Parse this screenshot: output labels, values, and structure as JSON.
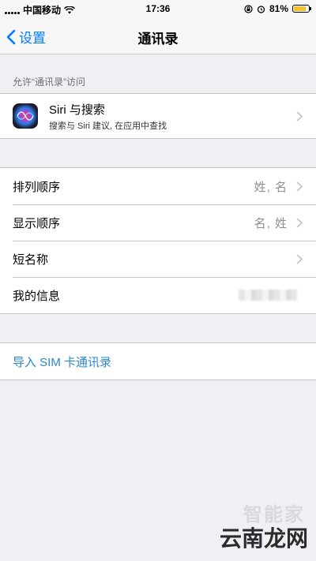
{
  "status_bar": {
    "carrier": "中国移动",
    "time": "17:36",
    "battery": "81%",
    "battery_level": 0.81,
    "icons": [
      "signal-icon",
      "wifi-icon",
      "orientation-lock-icon",
      "alarm-icon",
      "battery-icon"
    ]
  },
  "nav": {
    "back_label": "设置",
    "title": "通讯录"
  },
  "section1": {
    "header": "允许“通讯录”访问",
    "siri_title": "Siri 与搜索",
    "siri_subtitle": "搜索与 Siri 建议, 在应用中查找"
  },
  "settings": [
    {
      "label": "排列顺序",
      "value": "姓, 名"
    },
    {
      "label": "显示顺序",
      "value": "名, 姓"
    },
    {
      "label": "短名称",
      "value": ""
    },
    {
      "label": "我的信息",
      "value": ""
    }
  ],
  "import_sim": "导入 SIM 卡通讯录",
  "watermark": {
    "top": "智能家",
    "bottom": "云南龙网"
  },
  "colors": {
    "accent": "#007aff",
    "link": "#2a88c9",
    "background": "#efeff4",
    "battery": "#f2c12e"
  }
}
